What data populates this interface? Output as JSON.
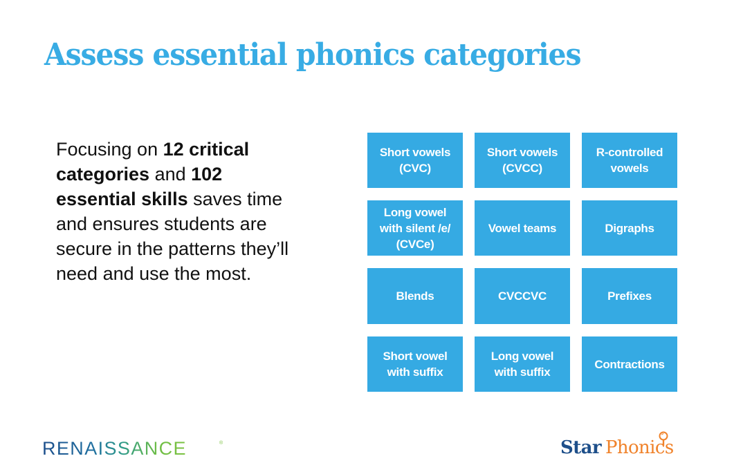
{
  "slide": {
    "title": "Assess essential phonics categories",
    "body": {
      "segments": [
        {
          "text": "Focusing on ",
          "bold": false
        },
        {
          "text": "12 critical categories",
          "bold": true
        },
        {
          "text": " and ",
          "bold": false
        },
        {
          "text": "102 essential skills",
          "bold": true
        },
        {
          "text": " saves time and ensures students are secure in the patterns they’ll need and use the most.",
          "bold": false
        }
      ]
    },
    "categories": [
      "Short vowels\n(CVC)",
      "Short vowels\n(CVCC)",
      "R-controlled\nvowels",
      "Long vowel\nwith silent /e/\n(CVCe)",
      "Vowel teams",
      "Digraphs",
      "Blends",
      "CVCCVC",
      "Prefixes",
      "Short vowel\nwith suffix",
      "Long vowel\nwith suffix",
      "Contractions"
    ],
    "colors": {
      "accent": "#38ACE4",
      "tile": "#35AAE3",
      "tile_text": "#FFFFFF",
      "body_text": "#111111"
    }
  },
  "footer": {
    "left_logo": {
      "text": "RENAISSANCE",
      "mark": "®",
      "icon": "registered-mark"
    },
    "right_logo": {
      "word1": "Star",
      "word2": "Phonics",
      "icon": "magnifying-glass-icon",
      "word1_color": "#1E4F8A",
      "word2_color": "#F0822A"
    }
  }
}
